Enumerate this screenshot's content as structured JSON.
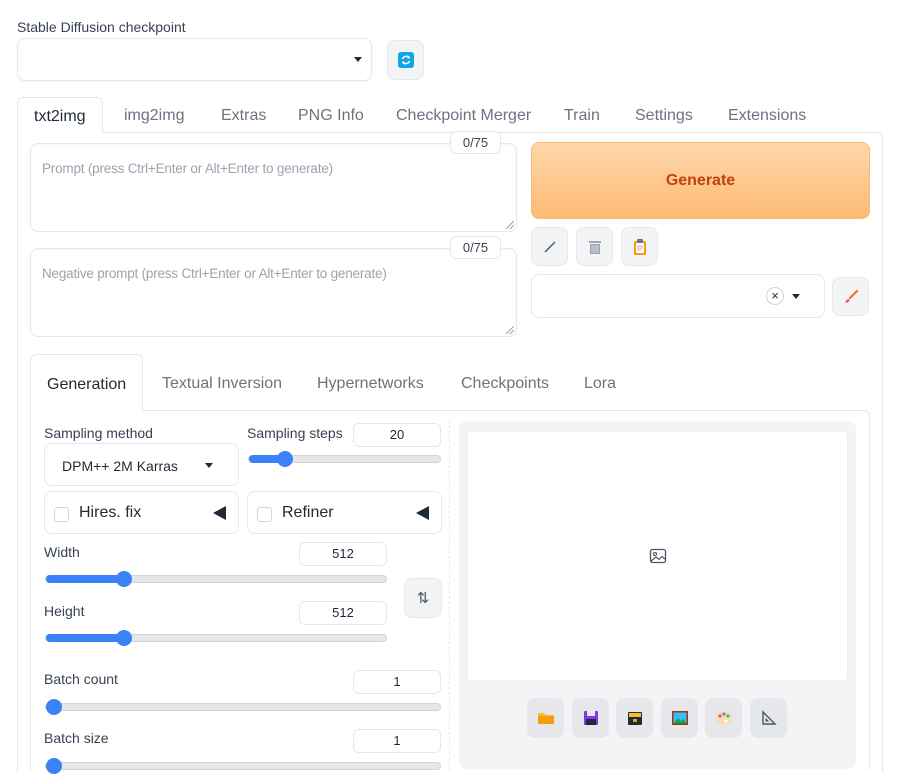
{
  "checkpoint": {
    "label": "Stable Diffusion checkpoint",
    "value": ""
  },
  "top_tabs": [
    {
      "label": "txt2img",
      "active": true
    },
    {
      "label": "img2img",
      "active": false
    },
    {
      "label": "Extras",
      "active": false
    },
    {
      "label": "PNG Info",
      "active": false
    },
    {
      "label": "Checkpoint Merger",
      "active": false
    },
    {
      "label": "Train",
      "active": false
    },
    {
      "label": "Settings",
      "active": false
    },
    {
      "label": "Extensions",
      "active": false
    }
  ],
  "prompt": {
    "placeholder": "Prompt (press Ctrl+Enter or Alt+Enter to generate)",
    "counter": "0/75"
  },
  "negative_prompt": {
    "placeholder": "Negative prompt (press Ctrl+Enter or Alt+Enter to generate)",
    "counter": "0/75"
  },
  "generate_label": "Generate",
  "inner_tabs": [
    {
      "label": "Generation",
      "active": true
    },
    {
      "label": "Textual Inversion",
      "active": false
    },
    {
      "label": "Hypernetworks",
      "active": false
    },
    {
      "label": "Checkpoints",
      "active": false
    },
    {
      "label": "Lora",
      "active": false
    }
  ],
  "sampling": {
    "method_label": "Sampling method",
    "method_value": "DPM++ 2M Karras",
    "steps_label": "Sampling steps",
    "steps_value": "20",
    "steps_fraction": 0.19
  },
  "hires_fix": {
    "label": "Hires. fix",
    "checked": false
  },
  "refiner": {
    "label": "Refiner",
    "checked": false
  },
  "width": {
    "label": "Width",
    "value": "512",
    "fraction": 0.23
  },
  "height": {
    "label": "Height",
    "value": "512",
    "fraction": 0.23
  },
  "batch_count": {
    "label": "Batch count",
    "value": "1",
    "fraction": 0.0
  },
  "batch_size": {
    "label": "Batch size",
    "value": "1",
    "fraction": 0.0
  },
  "colors": {
    "accent": "#3b82f6",
    "generate_text": "#c2410c",
    "generate_bg": "#fdba74"
  },
  "icons": [
    "refresh-icon",
    "pencil-icon",
    "trash-icon",
    "clipboard-icon",
    "clear-icon",
    "paint-brush-icon",
    "swap-icon",
    "image-icon",
    "folder-icon",
    "save-icon",
    "zip-icon",
    "picture-icon",
    "palette-icon",
    "ruler-icon"
  ]
}
